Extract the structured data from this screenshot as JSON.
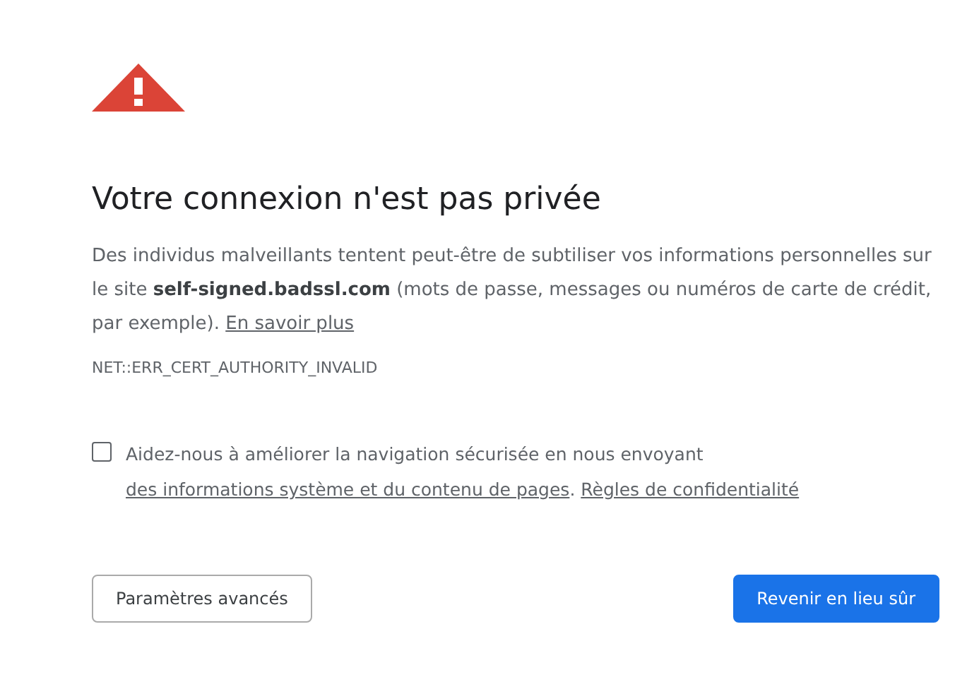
{
  "heading": "Votre connexion n'est pas privée",
  "description": [
    {
      "kind": "text",
      "text": "Des individus malveillants tentent peut-être de subtiliser vos informations personnelles sur le site **self-signed.badssl.com** (mots de passe, messages ou numéros de carte de crédit, par exemple). "
    },
    {
      "kind": "link",
      "text": "En savoir plus"
    }
  ],
  "error_code": "NET::ERR_CERT_AUTHORITY_INVALID",
  "opt_in": {
    "checked": false,
    "parts": [
      {
        "kind": "text",
        "text": "Aidez-nous à améliorer la navigation sécurisée en nous envoyant "
      },
      {
        "kind": "link",
        "text": "des informations système et du contenu de pages",
        "trailing": ". "
      },
      {
        "kind": "link",
        "text": "Règles de confidentialité"
      }
    ]
  },
  "buttons": [
    {
      "kind": "secondary",
      "label": "Paramètres avancés"
    },
    {
      "kind": "primary",
      "label": "Revenir en lieu sûr"
    }
  ]
}
